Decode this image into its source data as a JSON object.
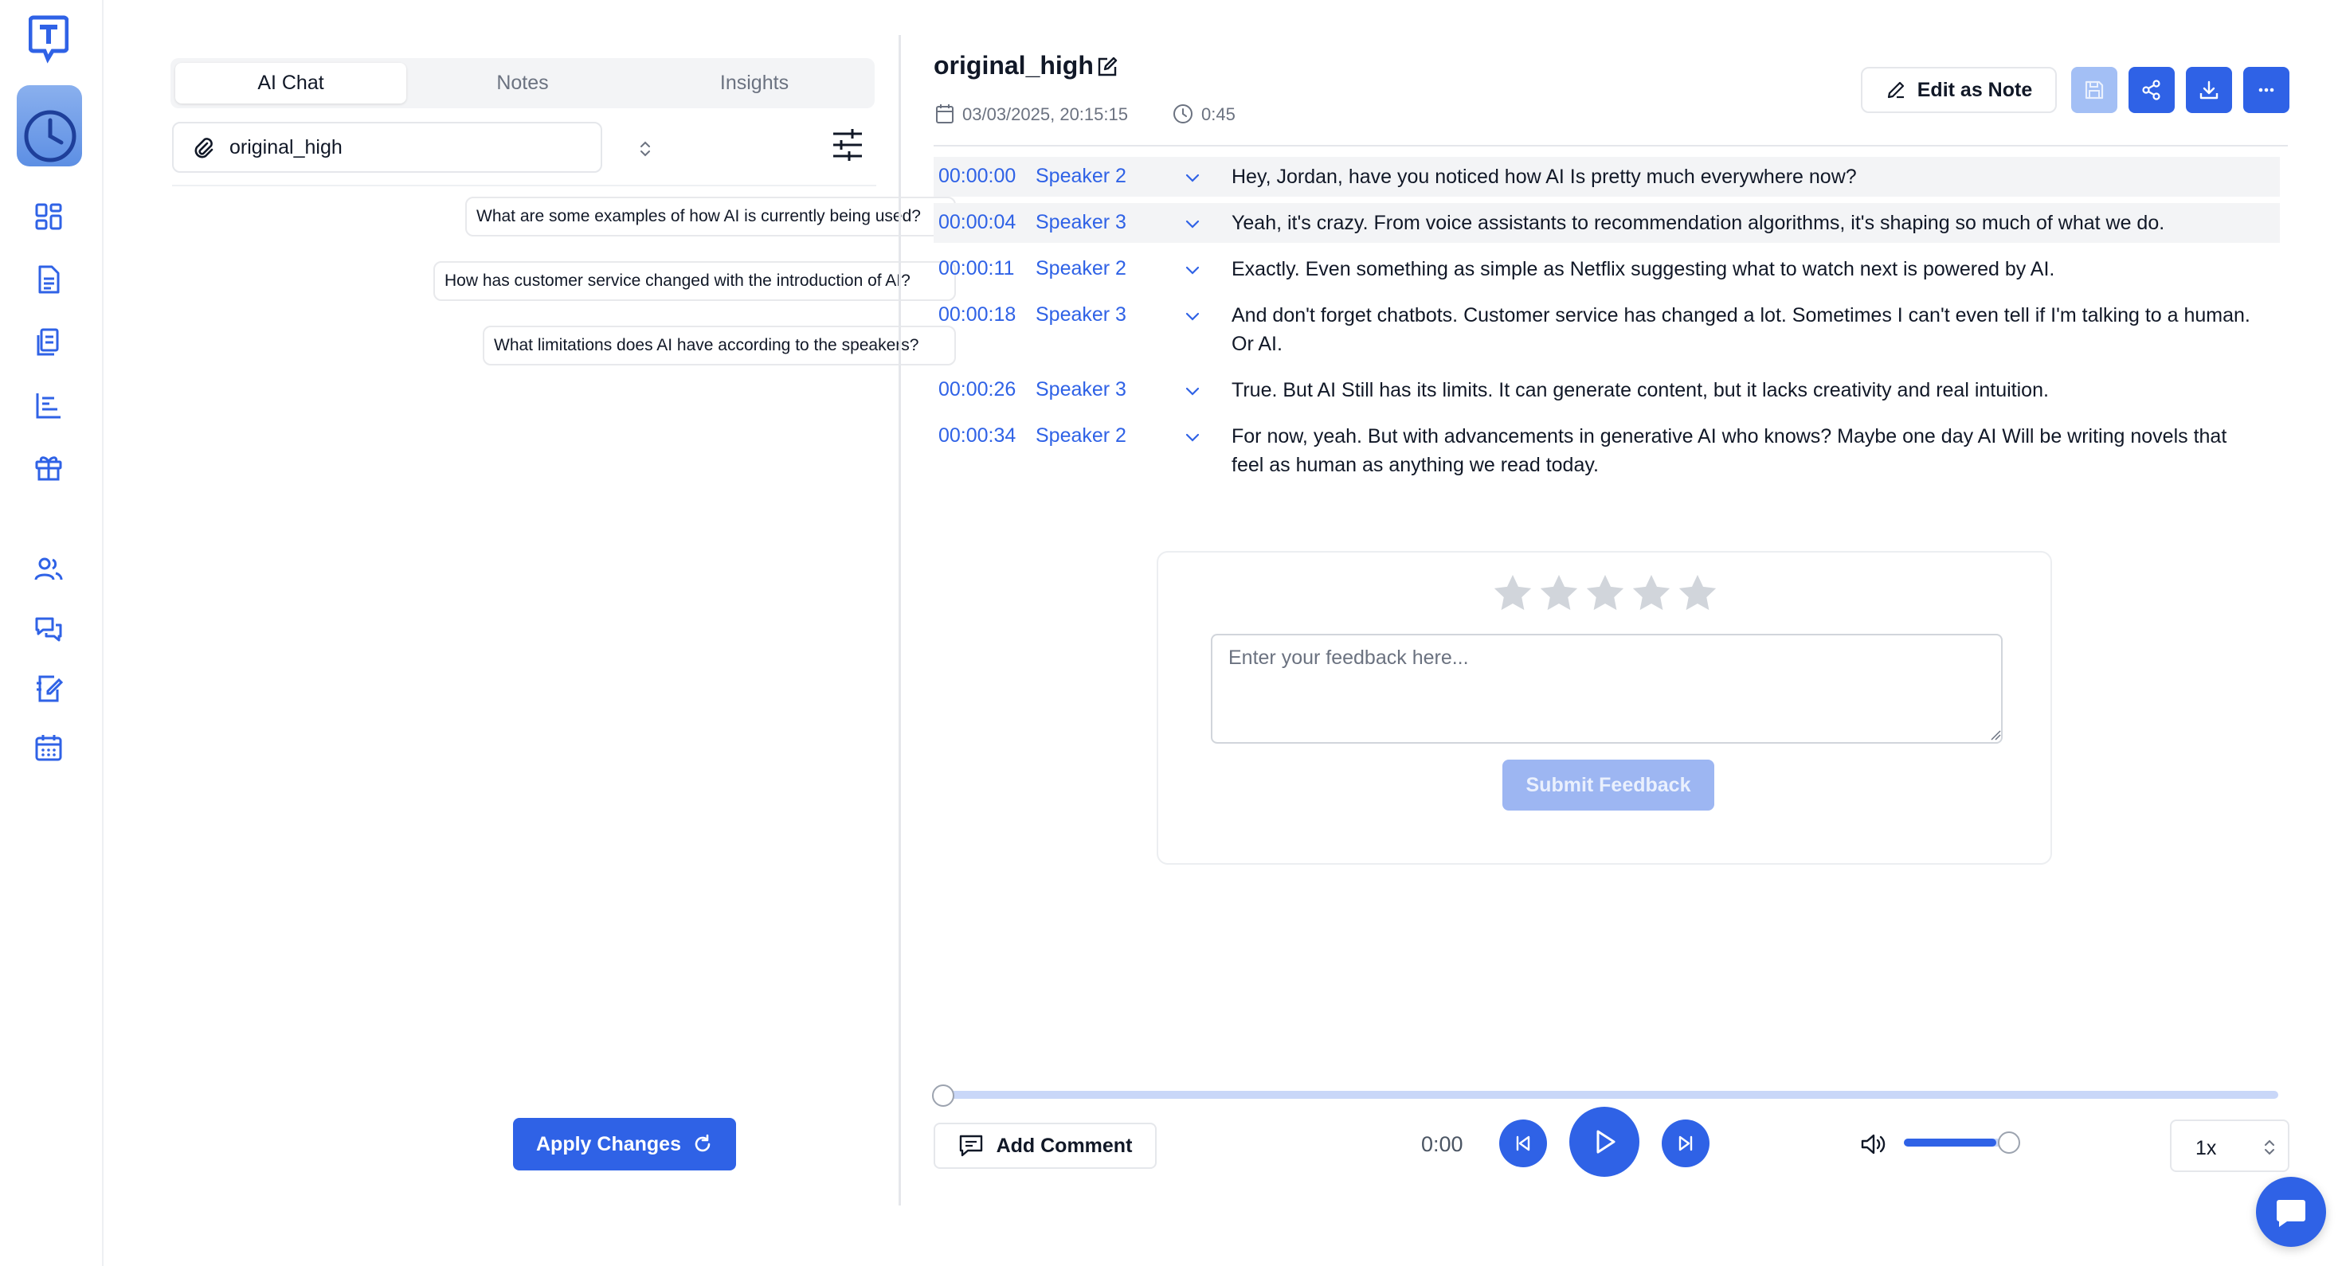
{
  "colors": {
    "accent": "#2f62e6",
    "accent_light": "#9db6f2",
    "muted_text": "#6b7280",
    "star_empty": "#d1d5db"
  },
  "rail": {
    "icons": [
      "logo-icon",
      "history-icon",
      "dashboard-icon",
      "document-icon",
      "files-icon",
      "reports-icon",
      "gift-icon",
      "users-icon",
      "chat-icon",
      "notes-icon",
      "calendar-icon"
    ]
  },
  "left_panel": {
    "tabs": [
      {
        "label": "AI Chat",
        "active": true
      },
      {
        "label": "Notes",
        "active": false
      },
      {
        "label": "Insights",
        "active": false
      }
    ],
    "file_select": {
      "value": "original_high"
    },
    "suggestions": [
      "What are some examples of how AI is currently being used?",
      "How has customer service changed with the introduction of AI?",
      "What limitations does AI have according to the speakers?"
    ],
    "apply_button": "Apply Changes"
  },
  "header": {
    "title": "original_high",
    "date": "03/03/2025, 20:15:15",
    "duration": "0:45",
    "edit_as_note": "Edit as Note"
  },
  "transcript": [
    {
      "time": "00:00:00",
      "speaker": "Speaker 2",
      "text": "Hey, Jordan, have you noticed how AI Is pretty much everywhere now?",
      "highlighted": true
    },
    {
      "time": "00:00:04",
      "speaker": "Speaker 3",
      "text": "Yeah, it's crazy.  From voice assistants to recommendation algorithms, it's shaping so much of what we do.",
      "highlighted": true
    },
    {
      "time": "00:00:11",
      "speaker": "Speaker 2",
      "text": "Exactly.  Even something as simple as Netflix suggesting what to watch next is powered by AI.",
      "highlighted": false
    },
    {
      "time": "00:00:18",
      "speaker": "Speaker 3",
      "text": "And don't forget chatbots. Customer service has changed a lot. Sometimes I can't even tell if I'm talking to a human. Or AI.",
      "highlighted": false
    },
    {
      "time": "00:00:26",
      "speaker": "Speaker 3",
      "text": "True. But AI Still has its limits. It can generate content, but it lacks creativity and real intuition.",
      "highlighted": false
    },
    {
      "time": "00:00:34",
      "speaker": "Speaker 2",
      "text": "For now, yeah. But with advancements in generative AI who knows? Maybe one day AI Will be writing novels that feel as human as anything we read today.",
      "highlighted": false
    }
  ],
  "feedback": {
    "rating": 0,
    "max_rating": 5,
    "placeholder": "Enter your feedback here...",
    "submit_label": "Submit Feedback"
  },
  "player": {
    "progress": 0,
    "add_comment": "Add Comment",
    "current_time": "0:00",
    "volume": 0.85,
    "speed": "1x"
  }
}
